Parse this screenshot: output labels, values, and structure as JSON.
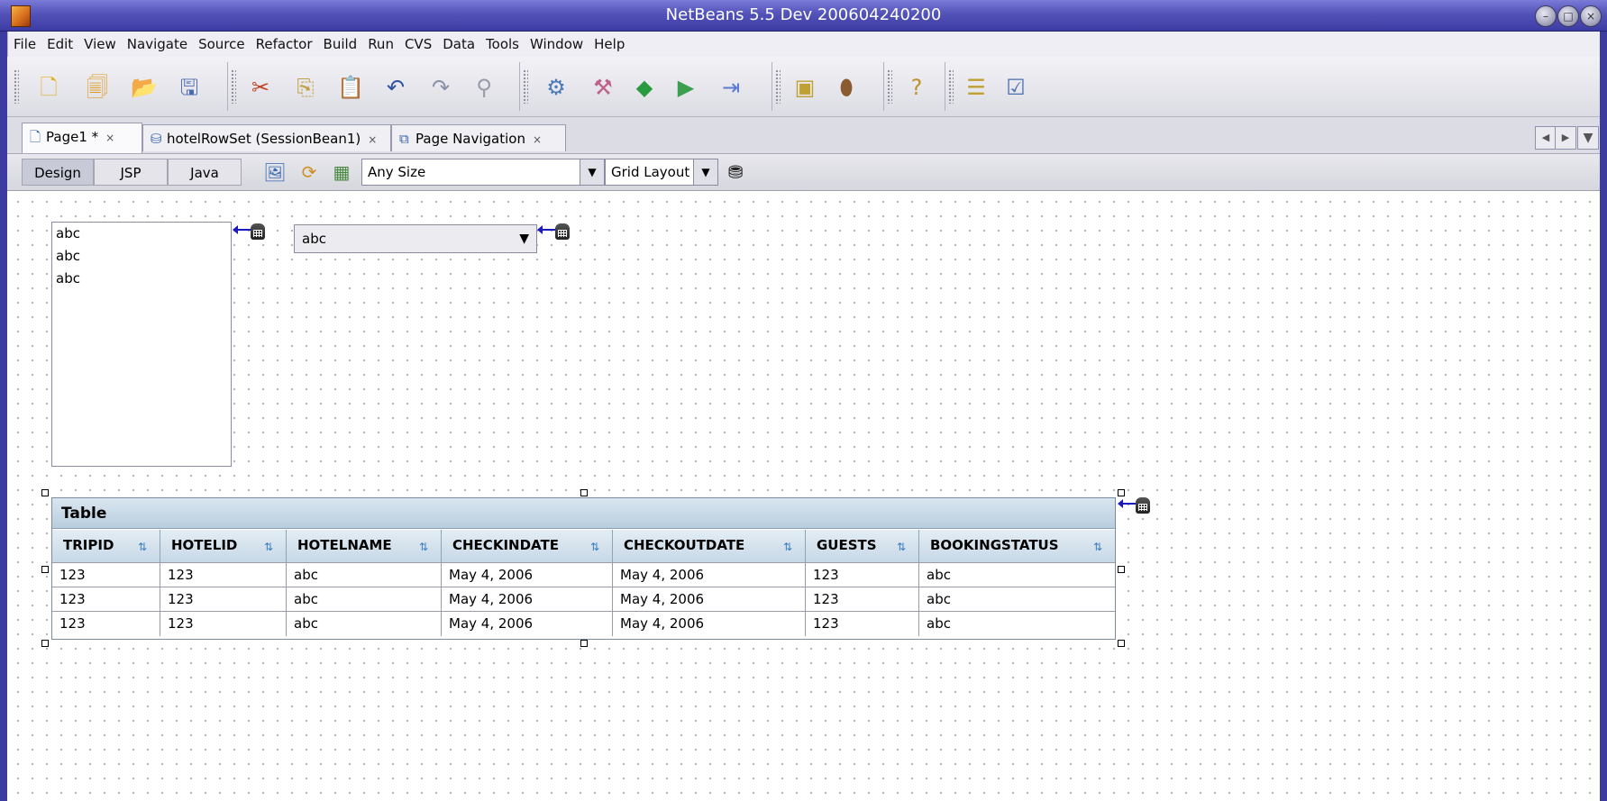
{
  "window": {
    "title": "NetBeans 5.5 Dev 200604240200"
  },
  "menu": [
    "File",
    "Edit",
    "View",
    "Navigate",
    "Source",
    "Refactor",
    "Build",
    "Run",
    "CVS",
    "Data",
    "Tools",
    "Window",
    "Help"
  ],
  "toolbar_icons": [
    "new-file-icon",
    "new-project-icon",
    "open-project-icon",
    "save-all-icon",
    "cut-icon",
    "copy-icon",
    "paste-icon",
    "undo-icon",
    "redo-icon",
    "find-icon",
    "build-main-icon",
    "clean-build-icon",
    "run-main-icon",
    "debug-main-icon",
    "step-icon",
    "palette-icon",
    "profiler-icon",
    "help-icon",
    "tasks-icon",
    "checklist-icon"
  ],
  "tabs": [
    {
      "label": "Page1 *",
      "icon": "page-icon",
      "active": true
    },
    {
      "label": "hotelRowSet (SessionBean1)",
      "icon": "rowset-icon",
      "active": false
    },
    {
      "label": "Page Navigation",
      "icon": "navigation-icon",
      "active": false
    }
  ],
  "editor": {
    "views": [
      "Design",
      "JSP",
      "Java"
    ],
    "selected_view": "Design",
    "size_combo": "Any Size",
    "layout_combo": "Grid Layout"
  },
  "listbox": {
    "items": [
      "abc",
      "abc",
      "abc"
    ]
  },
  "dropdown": {
    "value": "abc"
  },
  "table": {
    "title": "Table",
    "columns": [
      "TRIPID",
      "HOTELID",
      "HOTELNAME",
      "CHECKINDATE",
      "CHECKOUTDATE",
      "GUESTS",
      "BOOKINGSTATUS"
    ],
    "rows": [
      [
        "123",
        "123",
        "abc",
        "May 4, 2006",
        "May 4, 2006",
        "123",
        "abc"
      ],
      [
        "123",
        "123",
        "abc",
        "May 4, 2006",
        "May 4, 2006",
        "123",
        "abc"
      ],
      [
        "123",
        "123",
        "abc",
        "May 4, 2006",
        "May 4, 2006",
        "123",
        "abc"
      ]
    ]
  },
  "colors": {
    "titlebar": "#5252b8",
    "table_header": "#c6d8e6",
    "binding_arrow": "#1a1ac0"
  }
}
